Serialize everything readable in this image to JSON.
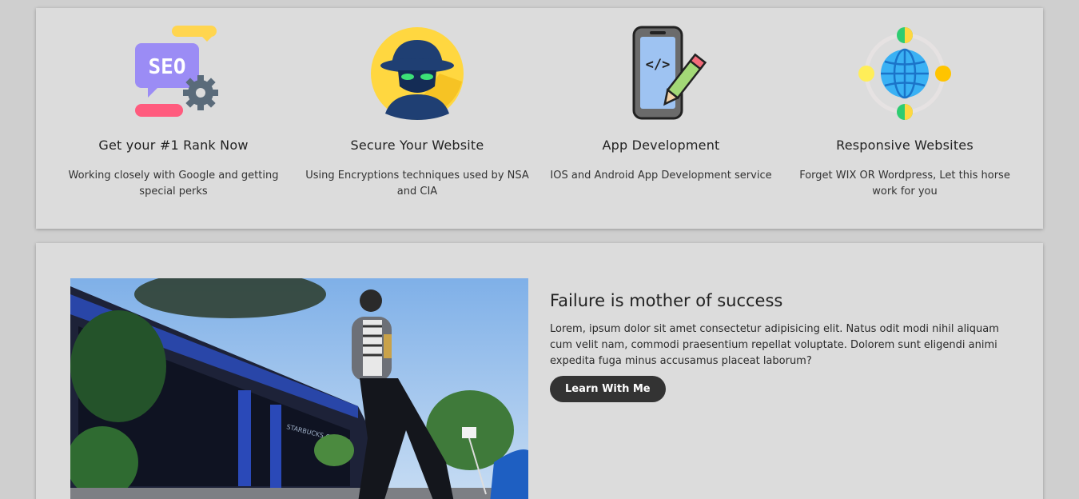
{
  "services": [
    {
      "icon": "seo-icon",
      "title": "Get your #1 Rank Now",
      "description": "Working closely with Google and getting special perks",
      "icon_text": "SEO"
    },
    {
      "icon": "hacker-spy-icon",
      "title": "Secure Your Website",
      "description": "Using Encryptions techniques used by NSA and CIA"
    },
    {
      "icon": "mobile-code-icon",
      "title": "App Development",
      "description": "IOS and Android App Development service",
      "icon_text": "</>"
    },
    {
      "icon": "globe-icon",
      "title": "Responsive Websites",
      "description": "Forget WIX OR Wordpress, Let this horse work for you"
    }
  ],
  "feature": {
    "title": "Failure is mother of success",
    "body": "Lorem, ipsum dolor sit amet consectetur adipisicing elit. Natus odit modi nihil aliquam cum velit nam, commodi praesentium repellat voluptate. Dolorem sunt eligendi animi expedita fuga minus accusamus placeat laborum?",
    "button_label": "Learn With Me",
    "photo_sign_text": "STARBUCKS COFFEE"
  },
  "colors": {
    "page_background": "#cfcfcf",
    "card_background": "#dcdcdc",
    "button_background": "#333333",
    "button_text": "#ffffff"
  }
}
